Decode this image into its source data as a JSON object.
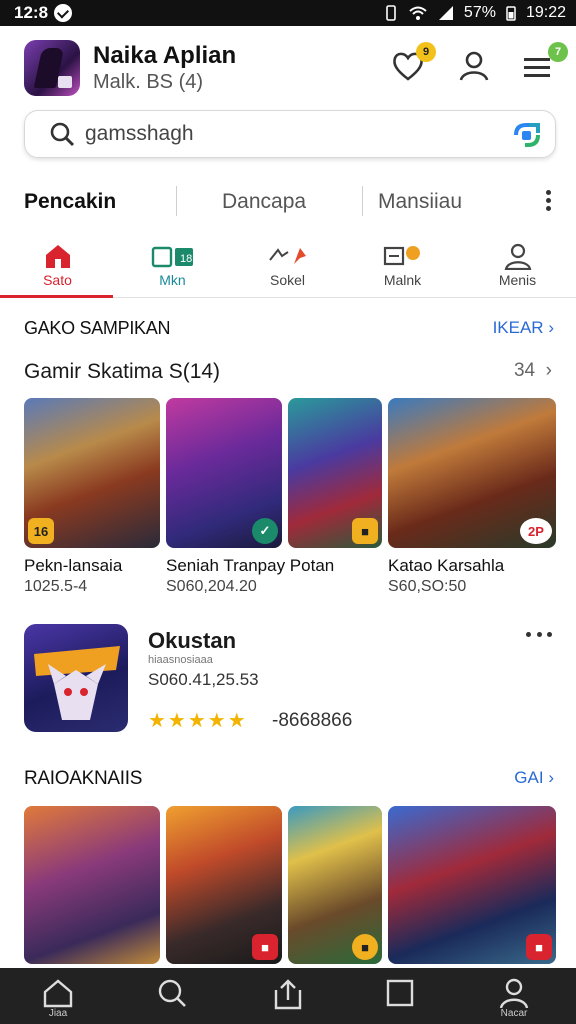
{
  "status_bar": {
    "time": "12:8",
    "battery": "57%",
    "clock": "19:22"
  },
  "header": {
    "title": "Naika Aplian",
    "subtitle": "Malk. BS (4)",
    "icons": [
      "wishlist-heart-icon",
      "account-icon",
      "menu-icon"
    ],
    "badges": {
      "wishlist": "9",
      "menu": "7"
    }
  },
  "search": {
    "value": "gamsshagh"
  },
  "categories": [
    "Pencakin",
    "Dancapa",
    "Mansiiau"
  ],
  "tabs": [
    {
      "label": "Sato",
      "icon": "home-icon"
    },
    {
      "label": "Mkn",
      "icon": "games-icon"
    },
    {
      "label": "Sokel",
      "icon": "social-icon"
    },
    {
      "label": "Malnk",
      "icon": "news-icon"
    },
    {
      "label": "Menis",
      "icon": "profile-icon"
    }
  ],
  "section1": {
    "title": "GAKO SAMPIKAN",
    "link": "IKEAR",
    "subheading": "Gamir  Skatima S(14)",
    "count": "34",
    "cards": [
      {
        "name": "Pekn-lansaia",
        "price": "1025.5-4",
        "tag": "16"
      },
      {
        "name": "Seniah Tranpay Potan",
        "price": "S060,204.20",
        "tag": ""
      },
      {
        "name": "",
        "price": "",
        "tag": ""
      },
      {
        "name": "Katao Karsahla",
        "price": "S60,SO:50",
        "tag": "2P"
      }
    ]
  },
  "featured": {
    "title": "Okustan",
    "developer": "hiaasnosiaaa",
    "price": "S060.41,25.53",
    "stars": "★★★★★",
    "rating": "-8668866"
  },
  "section2": {
    "title": "RAIOAKNAIIS",
    "link": "GAI"
  },
  "bottom_nav": [
    "Jiaa",
    "",
    "",
    "",
    "Nacar"
  ],
  "colors": {
    "accent": "#d9232e",
    "link": "#2a6ad6",
    "nav_bg": "#222222"
  }
}
